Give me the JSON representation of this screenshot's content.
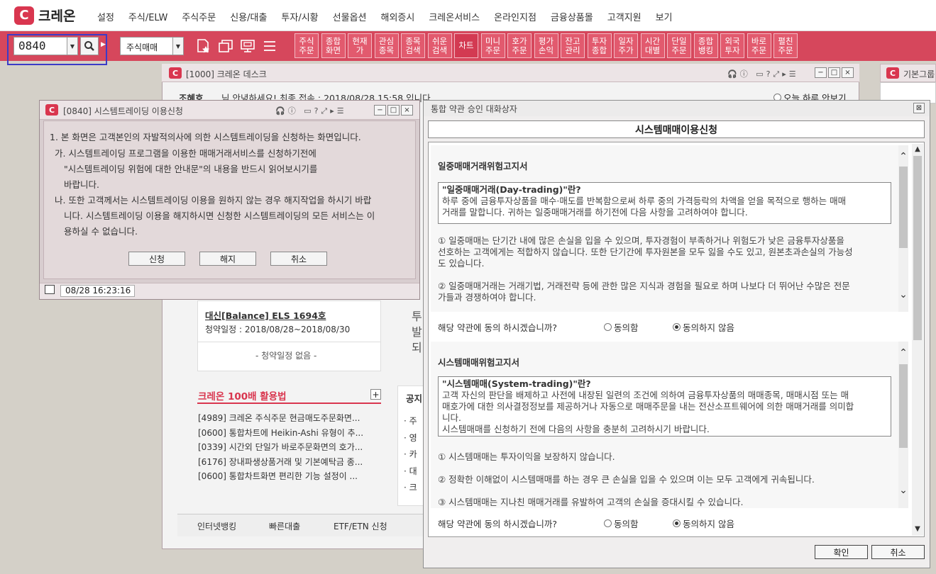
{
  "brand": {
    "logo": "C",
    "name": "크레온"
  },
  "menu": [
    "설정",
    "주식/ELW",
    "주식주문",
    "신용/대출",
    "투자/시황",
    "선물옵션",
    "해외증시",
    "크레온서비스",
    "온라인지점",
    "금융상품몰",
    "고객지원",
    "보기"
  ],
  "toolbar": {
    "code_value": "0840",
    "trade_select": "주식매매",
    "quick_buttons": [
      "주식\n주문",
      "종합\n화면",
      "현재\n가",
      "관심\n종목",
      "종목\n검색",
      "쉬운\n검색",
      "차트",
      "미니\n주문",
      "호가\n주문",
      "평가\n손익",
      "잔고\n관리",
      "투자\n종합",
      "일자\n주가",
      "시간\n대별",
      "단일\n주문",
      "종합\n뱅킹",
      "외국\n투자",
      "바로\n주문",
      "펼친\n주문"
    ]
  },
  "desk": {
    "title": "[1000] 크레온 데스크",
    "greeting": "조혜호",
    "greet_msg": "님 안녕하세요!  최종 접속 : 2018/08/28 15:58 입니다.",
    "no_show_today": "오늘 하루 안보기",
    "product_title": "대신[Balance] ELS 1694호",
    "product_period": "청약일정 : 2018/08/28~2018/08/30",
    "no_schedule": "- 청약일정 없음 -",
    "tips_title": "크레온 100배 활용법",
    "tips_plus": "+",
    "tips": [
      "[4989] 크레온 주식주문 현금매도주문화면...",
      "[0600] 통합차트에 Heikin-Ashi 유형이 추...",
      "[0339] 시간외 단일가 바로주문화면의 호가...",
      "[6176] 장내파생상품거래 및 기본예탁금 종...",
      "[0600] 통합차트화면 편리한 기능 설정이 ..."
    ],
    "notice_title": "공지",
    "notice_partial": [
      "주",
      "영",
      "카",
      "대",
      "크"
    ],
    "right_partial": [
      "투",
      "발",
      "되"
    ],
    "bottom_tabs": [
      "인터넷뱅킹",
      "빠른대출",
      "ETF/ETN 신청"
    ]
  },
  "side": {
    "title": "기본그룹"
  },
  "st_window": {
    "title": "[0840] 시스템트레이딩 이용신청",
    "lines": [
      "1. 본 화면은 고객본인의 자발적의사에 의한 시스템트레이딩을 신청하는 화면입니다.",
      "가. 시스템트레이딩 프로그램을 이용한 매매거래서비스를 신청하기전에",
      "\"시스템트레이딩 위험에 대한 안내문\"의 내용을 반드시 읽어보시기를",
      "바랍니다.",
      "나. 또한 고객께서는 시스템트레이딩 이용을 원하지 않는 경우 해지작업을 하시기 바랍",
      "니다. 시스템트레이딩 이용을 해지하시면 신청한 시스템트레이딩의 모든 서비스는 이",
      "용하실 수 없습니다."
    ],
    "buttons": [
      "신청",
      "해지",
      "취소"
    ],
    "status_time": "08/28  16:23:16"
  },
  "dialog": {
    "title": "통합 약관 승인 대화상자",
    "header": "시스템매매이용신청",
    "sec1": {
      "title": "일중매매거래위험고지서",
      "box_title": "\"일중매매거래(Day-trading)\"란?",
      "box_lines": [
        "하루 중에 금융투자상품을 매수·매도를 반복함으로써 하루 중의 가격등락의 차액을 얻을 목적으로 행하는 매매",
        "거래를 말합니다. 귀하는 일중매매거래를 하기전에 다음 사항을 고려하여야 합니다."
      ],
      "p1": [
        "① 일중매매는 단기간 내에 많은 손실을 입을 수 있으며, 투자경험이 부족하거나 위험도가 낮은 금융투자상품을",
        "선호하는 고객에게는 적합하지 않습니다. 또한 단기간에 투자원본을 모두 잃을 수도 있고, 원본초과손실의 가능성",
        "도 있습니다."
      ],
      "p2": [
        "② 일중매매거래는 거래기법, 거래전략 등에 관한 많은 지식과 경험을 필요로 하며 나보다 더 뛰어난 수많은 전문",
        "가들과 경쟁하여야 합니다."
      ]
    },
    "sec2": {
      "title": "시스템매매위험고지서",
      "box_title": "\"시스템매매(System-trading)\"란?",
      "box_lines": [
        "고객 자신의 판단을 배제하고 사전에 내장된 일련의 조건에 의하여 금융투자상품의 매매종목, 매매시점 또는 매",
        "매호가에 대한 의사결정정보를 제공하거나 자동으로 매매주문을 내는 전산소프트웨어에 의한 매매거래를 의미합",
        "니다.",
        "시스템매매를 신청하기 전에 다음의 사항을 충분히 고려하시기 바랍니다."
      ],
      "p1": "① 시스템매매는 투자이익을 보장하지 않습니다.",
      "p2": "② 정확한 이해없이 시스템매매를 하는 경우 큰 손실을 입을 수 있으며 이는 모두 고객에게 귀속됩니다.",
      "p3": "③ 시스템매매는 지나친 매매거래를 유발하여 고객의 손실을 증대시킬 수 있습니다."
    },
    "agree_q": "해당 약관에 동의 하시겠습니까?",
    "agree": "동의함",
    "disagree": "동의하지 않음",
    "ok": "확인",
    "cancel": "취소"
  }
}
